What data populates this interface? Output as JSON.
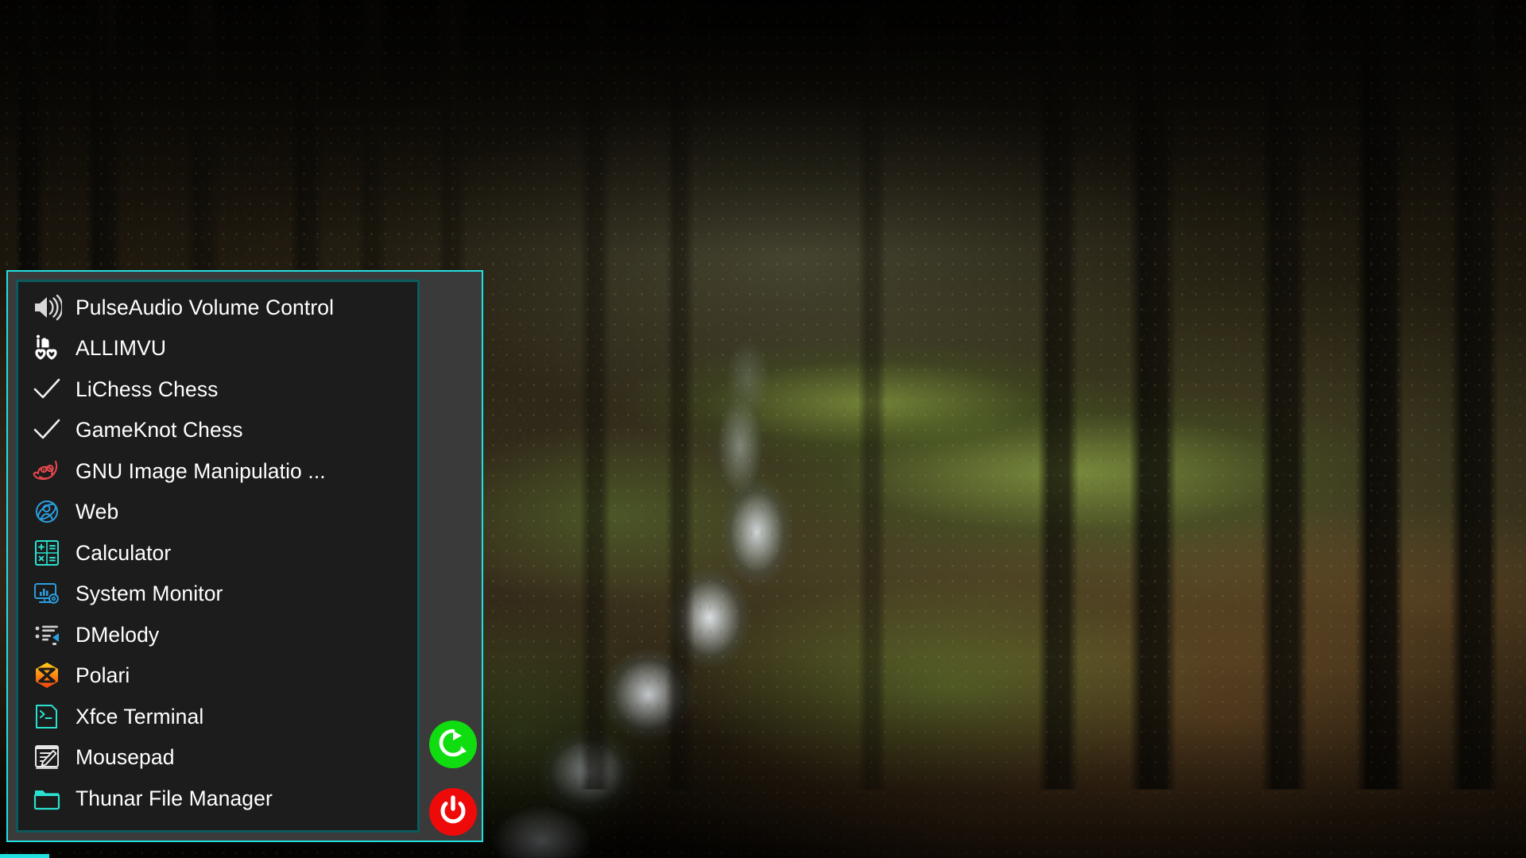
{
  "desktop": {
    "wallpaper_description": "dark forest path beside a sunlit stream",
    "background_color": "#100d08"
  },
  "app_menu": {
    "panel_background": "#3a3a3a",
    "panel_border_color": "#21e0e0",
    "list_background": "#1c1c1c",
    "list_border_color": "#0d5a5c",
    "items": [
      {
        "label": "PulseAudio Volume Control",
        "icon": "speaker-volume-icon"
      },
      {
        "label": "ALLIMVU",
        "icon": "imvu-logo-icon"
      },
      {
        "label": "LiChess Chess",
        "icon": "checkmark-icon"
      },
      {
        "label": "GameKnot Chess",
        "icon": "checkmark-icon"
      },
      {
        "label": "GNU Image Manipulatio ...",
        "icon": "gimp-wilber-icon"
      },
      {
        "label": "Web",
        "icon": "web-globe-icon"
      },
      {
        "label": "Calculator",
        "icon": "calculator-icon"
      },
      {
        "label": "System Monitor",
        "icon": "system-monitor-icon"
      },
      {
        "label": "DMelody",
        "icon": "playlist-play-icon"
      },
      {
        "label": "Polari",
        "icon": "polari-hexagon-icon"
      },
      {
        "label": "Xfce Terminal",
        "icon": "terminal-prompt-icon"
      },
      {
        "label": "Mousepad",
        "icon": "notepad-pencil-icon"
      },
      {
        "label": "Thunar File Manager",
        "icon": "folder-icon"
      }
    ],
    "session": {
      "restart": {
        "icon": "restart-circular-arrow-icon",
        "color": "#10dd10"
      },
      "shutdown": {
        "icon": "power-icon",
        "color": "#ef0a0a"
      }
    }
  }
}
